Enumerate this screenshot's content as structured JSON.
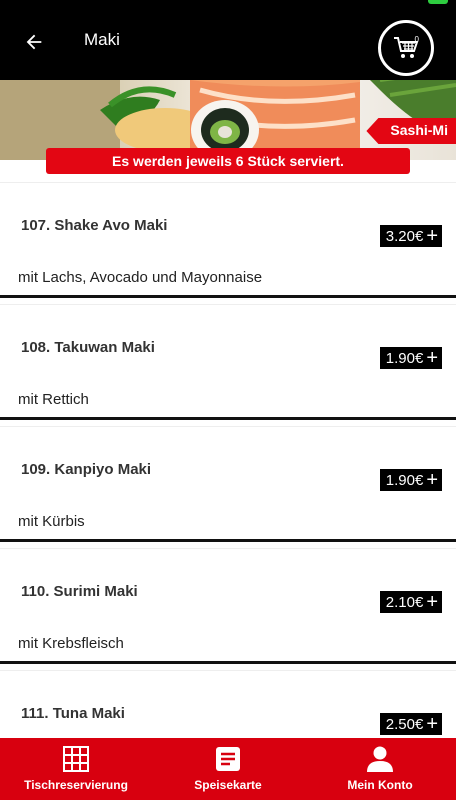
{
  "header": {
    "title": "Maki",
    "cart_count": "0"
  },
  "banner": {
    "tag": "Sashi-Mi",
    "note": "Es werden jeweils 6 Stück serviert."
  },
  "items": [
    {
      "name": "107. Shake Avo Maki",
      "price": "3.20€",
      "description": "mit Lachs, Avocado und Mayonnaise"
    },
    {
      "name": "108. Takuwan Maki",
      "price": "1.90€",
      "description": "mit Rettich"
    },
    {
      "name": "109. Kanpiyo Maki",
      "price": "1.90€",
      "description": "mit Kürbis"
    },
    {
      "name": "110. Surimi Maki",
      "price": "2.10€",
      "description": "mit Krebsfleisch"
    },
    {
      "name": "111. Tuna Maki",
      "price": "2.50€",
      "description": ""
    }
  ],
  "bottom_nav": [
    {
      "label": "Tischreservierung",
      "icon": "grid-icon"
    },
    {
      "label": "Speisekarte",
      "icon": "menu-list-icon"
    },
    {
      "label": "Mein Konto",
      "icon": "user-icon"
    }
  ],
  "colors": {
    "accent": "#e30613",
    "nav": "#d8000f",
    "header": "#000000"
  }
}
